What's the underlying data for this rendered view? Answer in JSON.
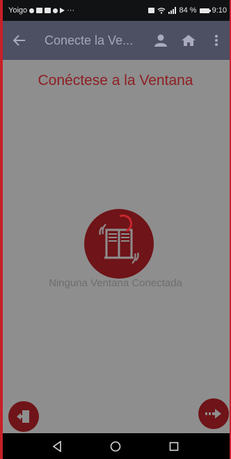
{
  "status_bar": {
    "carrier": "Yoigo",
    "battery_text": "84 %",
    "time": "9:10",
    "icons": [
      "notification-dot-icon",
      "notification-box-icon",
      "image-icon",
      "chat-icon",
      "play-icon",
      "more-notifications-icon",
      "nfc-icon",
      "wifi-icon",
      "signal-icon",
      "battery-icon"
    ]
  },
  "app_bar": {
    "title": "Conecte la Ve...",
    "icons": [
      "back-arrow-icon",
      "user-icon",
      "home-icon",
      "more-vert-icon"
    ]
  },
  "main": {
    "heading": "Conéctese a la Ventana",
    "status_message": "Ninguna Ventana Conectada",
    "center_icon": "window-icon"
  },
  "fabs": {
    "left_icon": "exit-door-icon",
    "right_icon": "next-arrow-icon"
  },
  "nav_bar": {
    "icons": [
      "back-triangle-icon",
      "home-circle-icon",
      "recents-square-icon"
    ]
  },
  "colors": {
    "accent": "#c62028",
    "heading": "#8e1e22",
    "app_bar": "#4d4f63",
    "overlay": "#8e8e8e"
  }
}
